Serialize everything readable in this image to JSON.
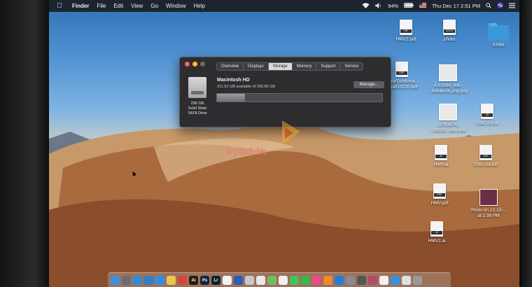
{
  "menubar": {
    "app": "Finder",
    "items": [
      "File",
      "Edit",
      "View",
      "Go",
      "Window",
      "Help"
    ],
    "battery": "94%",
    "clock": "Thu Dec 17  2:51 PM"
  },
  "about": {
    "tabs": [
      "Overview",
      "Displays",
      "Storage",
      "Memory",
      "Support",
      "Service"
    ],
    "active_tab": "Storage",
    "volume_name": "Macintosh HD",
    "available": "211.52 GB available of 255.85 GB",
    "used_fraction": 0.17,
    "manage_label": "Manage...",
    "disk_caption": [
      "256 GB",
      "Solid State",
      "SATA Drive"
    ]
  },
  "desktop_icons": [
    {
      "label": "HMV2.pdf",
      "icon": "pdf-document-icon",
      "tag": "PDF"
    },
    {
      "label": "photo",
      "icon": "docx-document-icon",
      "tag": "DOCX"
    },
    {
      "label": "KN96",
      "icon": "folder-icon",
      "tag": ""
    },
    {
      "label": "...sferConfirma...\n...4a619220.pdf",
      "icon": "pdf-document-icon",
      "tag": "PDF"
    },
    {
      "label": "6-62996_title-\n...border-tit.png.png",
      "icon": "png-image-icon",
      "tag": ""
    },
    {
      "label": "...27b3e74...\n...fa5b3...png.png",
      "icon": "png-image-icon",
      "tag": ""
    },
    {
      "label": "CNC cut.ai",
      "icon": "ai-document-icon",
      "tag": "AI"
    },
    {
      "label": "HMV.ai",
      "icon": "ai-document-icon",
      "tag": "AI"
    },
    {
      "label": "CNC cut.dxf",
      "icon": "dxf-document-icon",
      "tag": "DXF"
    },
    {
      "label": "HMV.pdf",
      "icon": "pdf-document-icon",
      "tag": "PDF"
    },
    {
      "label": "Photo on 12-13-...\nat 1.38 PM",
      "icon": "photo-thumbnail-icon",
      "tag": ""
    },
    {
      "label": "HMV2.ai",
      "icon": "ai-document-icon",
      "tag": "AI"
    }
  ],
  "watermark": "5ynd.lk",
  "dock": [
    {
      "icon": "finder-icon",
      "color": "#3f8fe0",
      "text": ""
    },
    {
      "icon": "launchpad-icon",
      "color": "#6a6a7a",
      "text": ""
    },
    {
      "icon": "safari-icon",
      "color": "#2b8fd8",
      "text": ""
    },
    {
      "icon": "safari-compass-icon",
      "color": "#2d7fc9",
      "text": ""
    },
    {
      "icon": "app-store-icon",
      "color": "#2f8ee6",
      "text": ""
    },
    {
      "icon": "notes-icon",
      "color": "#e9c94a",
      "text": ""
    },
    {
      "icon": "chrome-icon",
      "color": "#d9443a",
      "text": ""
    },
    {
      "icon": "illustrator-icon",
      "color": "#2a1a0c",
      "text": "Ai"
    },
    {
      "icon": "photoshop-icon",
      "color": "#0c2740",
      "text": "Ps"
    },
    {
      "icon": "lightroom-icon",
      "color": "#0d2233",
      "text": "Lr"
    },
    {
      "icon": "calendar-icon",
      "color": "#f2f2f2",
      "text": ""
    },
    {
      "icon": "word-icon",
      "color": "#2b5fb3",
      "text": ""
    },
    {
      "icon": "preview-icon",
      "color": "#c9c9c9",
      "text": ""
    },
    {
      "icon": "pages-icon",
      "color": "#e8e8e8",
      "text": ""
    },
    {
      "icon": "maps-icon",
      "color": "#6fbf5a",
      "text": ""
    },
    {
      "icon": "photos-icon",
      "color": "#f0f0f0",
      "text": ""
    },
    {
      "icon": "messages-icon",
      "color": "#49c05a",
      "text": ""
    },
    {
      "icon": "facetime-icon",
      "color": "#3fb24d",
      "text": ""
    },
    {
      "icon": "itunes-icon",
      "color": "#ea4c89",
      "text": ""
    },
    {
      "icon": "ibooks-icon",
      "color": "#f08a2d",
      "text": ""
    },
    {
      "icon": "app-icon",
      "color": "#1f7fd6",
      "text": ""
    },
    {
      "icon": "settings-icon",
      "color": "#8a8a8f",
      "text": ""
    },
    {
      "icon": "activity-icon",
      "color": "#555",
      "text": ""
    },
    {
      "icon": "photo-thumb-icon",
      "color": "#b24a6a",
      "text": ""
    },
    {
      "icon": "document-icon",
      "color": "#f2f2f2",
      "text": ""
    },
    {
      "icon": "downloads-icon",
      "color": "#3b8fdc",
      "text": ""
    },
    {
      "icon": "document-stack-icon",
      "color": "#e0e0e0",
      "text": ""
    },
    {
      "icon": "trash-icon",
      "color": "#9a9a9a",
      "text": ""
    }
  ]
}
